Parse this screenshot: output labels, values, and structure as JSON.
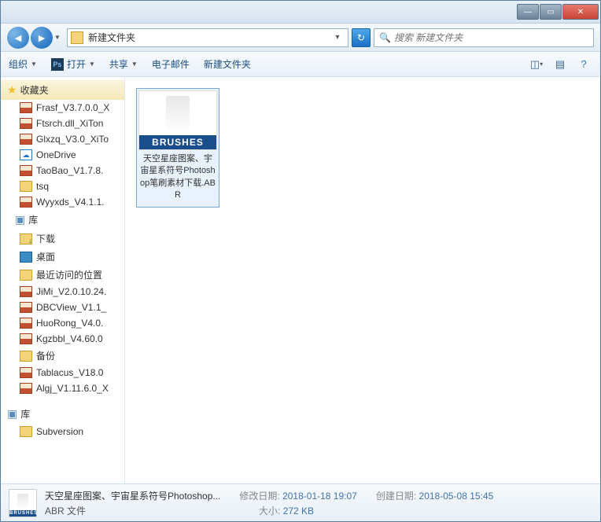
{
  "window": {
    "title": ""
  },
  "address": {
    "path": "新建文件夹"
  },
  "search": {
    "placeholder": "搜索 新建文件夹"
  },
  "toolbar": {
    "organize": "组织",
    "open": "打开",
    "share": "共享",
    "email": "电子邮件",
    "newfolder": "新建文件夹"
  },
  "sidebar": {
    "favorites_label": "收藏夹",
    "libraries_label": "库",
    "libraries_label2": "库",
    "subversion": "Subversion",
    "items": [
      {
        "name": "Frasf_V3.7.0.0_X",
        "type": "rar"
      },
      {
        "name": "Ftsrch.dll_XiTon",
        "type": "rar"
      },
      {
        "name": "Glxzq_V3.0_XiTo",
        "type": "rar"
      },
      {
        "name": "OneDrive",
        "type": "od"
      },
      {
        "name": "TaoBao_V1.7.8.",
        "type": "rar"
      },
      {
        "name": "tsq",
        "type": "fld"
      },
      {
        "name": "Wyyxds_V4.1.1.",
        "type": "rar"
      }
    ],
    "lib_items": [
      {
        "name": "下载",
        "type": "dl"
      },
      {
        "name": "桌面",
        "type": "desk"
      },
      {
        "name": "最近访问的位置",
        "type": "loc"
      },
      {
        "name": "JiMi_V2.0.10.24.",
        "type": "rar"
      },
      {
        "name": "DBCView_V1.1_",
        "type": "rar"
      },
      {
        "name": "HuoRong_V4.0.",
        "type": "rar"
      },
      {
        "name": "Kgzbbl_V4.60.0",
        "type": "rar"
      },
      {
        "name": "备份",
        "type": "fld"
      },
      {
        "name": "Tablacus_V18.0",
        "type": "rar"
      },
      {
        "name": "Algj_V1.11.6.0_X",
        "type": "rar"
      }
    ]
  },
  "content": {
    "file": {
      "thumb_label": "BRUSHES",
      "name": "天空星座图案、宇宙星系符号Photoshop笔刷素材下载.ABR"
    }
  },
  "details": {
    "name": "天空星座图案、宇宙星系符号Photoshop...",
    "type": "ABR 文件",
    "modified_label": "修改日期:",
    "modified": "2018-01-18 19:07",
    "created_label": "创建日期:",
    "created": "2018-05-08 15:45",
    "size_label": "大小:",
    "size": "272 KB"
  }
}
